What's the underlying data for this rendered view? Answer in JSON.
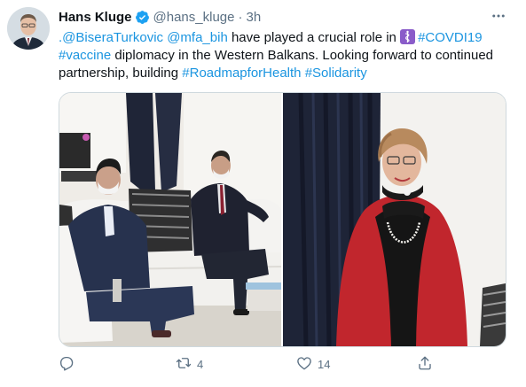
{
  "tweet": {
    "author_name": "Hans Kluge",
    "handle": "@hans_kluge",
    "separator": "·",
    "time": "3h",
    "text_parts": {
      "m1": ".@BiseraTurkovic",
      "s1": " ",
      "m2": "@mfa_bih",
      "t1": " have played a crucial role in ",
      "h1": "#COVDI19",
      "t2": " ",
      "h2": "#vaccine",
      "t3": " diplomacy in the Western Balkans. Looking forward to continued partnership, building ",
      "h3": "#RoadmapforHealth",
      "t4": " ",
      "h4": "#Solidarity"
    }
  },
  "actions": {
    "reply_count": "",
    "retweet_count": "4",
    "like_count": "14"
  },
  "icons": {
    "verified": "verified-badge-icon",
    "more": "more-horizontal-icon",
    "emoji": "health-emoji-icon",
    "reply": "reply-icon",
    "retweet": "retweet-icon",
    "like": "heart-icon",
    "share": "share-icon"
  },
  "colors": {
    "link": "#1b95e0",
    "verified": "#1da1f2",
    "muted": "#5b7083",
    "text": "#0f1419"
  }
}
